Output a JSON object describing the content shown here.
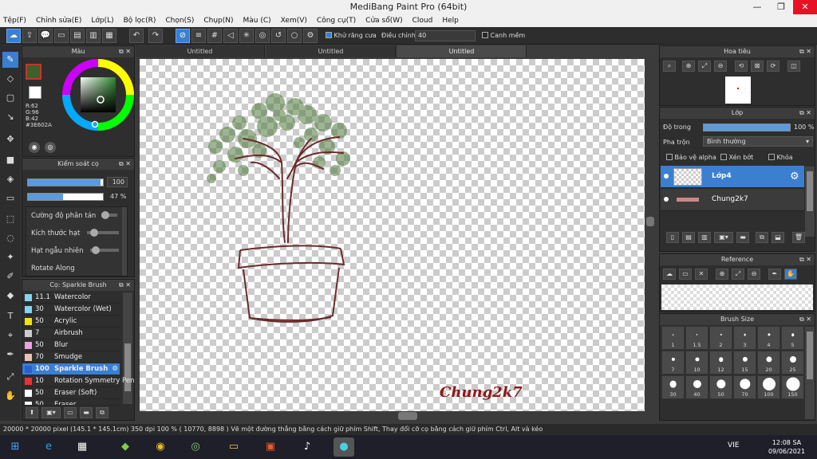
{
  "window": {
    "title": "MediBang Paint Pro (64bit)"
  },
  "menu": [
    "Tệp(F)",
    "Chỉnh sửa(E)",
    "Lớp(L)",
    "Bộ lọc(R)",
    "Chọn(S)",
    "Chụp(N)",
    "Màu (C)",
    "Xem(V)",
    "Công cụ(T)",
    "Cửa sổ(W)",
    "Cloud",
    "Help"
  ],
  "toolbar": {
    "antialias_label": "Khử răng cưa",
    "adjust_label": "Điều chỉnh",
    "adjust_value": "40",
    "edge_label": "Canh mềm"
  },
  "color_panel": {
    "title": "Màu",
    "r": "R:62",
    "g": "G:96",
    "b": "B:42",
    "hex": "#3E602A",
    "accent": "#3e602a"
  },
  "brush_control": {
    "title": "Kiểm soát cọ",
    "size_value": "100",
    "opacity_value": "47 %",
    "opacity_fraction": 0.47,
    "props": [
      "Cường độ phân tán",
      "Kích thước hạt",
      "Hạt ngẫu nhiên",
      "Rotate Along"
    ]
  },
  "brush_list": {
    "title": "Cọ: Sparkle Brush",
    "items": [
      {
        "size": "11.1",
        "name": "Watercolor",
        "color": "#7fd6f0"
      },
      {
        "size": "30",
        "name": "Watercolor (Wet)",
        "color": "#7fd6f0"
      },
      {
        "size": "50",
        "name": "Acrylic",
        "color": "#f0e020"
      },
      {
        "size": "7",
        "name": "Airbrush",
        "color": "#cccccc"
      },
      {
        "size": "50",
        "name": "Blur",
        "color": "#f0a0e0"
      },
      {
        "size": "70",
        "name": "Smudge",
        "color": "#f0c0b0"
      },
      {
        "size": "100",
        "name": "Sparkle Brush",
        "color": "#2a5fd0"
      },
      {
        "size": "10",
        "name": "Rotation Symmetry Pen",
        "color": "#f03030"
      },
      {
        "size": "50",
        "name": "Eraser (Soft)",
        "color": "#ffffff"
      },
      {
        "size": "50",
        "name": "Eraser",
        "color": "#ffffff"
      }
    ]
  },
  "tabs": [
    "Untitled",
    "Untitled",
    "Untitled"
  ],
  "canvas": {
    "signature": "Chung2k7"
  },
  "navigator": {
    "title": "Hoa tiêu"
  },
  "layers": {
    "title": "Lớp",
    "opacity_label": "Độ trong",
    "opacity_value": "100 %",
    "blend_label": "Pha trộn",
    "blend_value": "Bình thường",
    "protect_alpha": "Bảo vệ alpha",
    "clipping": "Xén bớt",
    "lock": "Khóa",
    "items": [
      {
        "name": "Lớp4"
      },
      {
        "name": "Chung2k7"
      }
    ]
  },
  "reference": {
    "title": "Reference"
  },
  "brush_size": {
    "title": "Brush Size",
    "sizes": [
      "1",
      "1.5",
      "2",
      "3",
      "4",
      "5",
      "7",
      "10",
      "12",
      "15",
      "20",
      "25",
      "30",
      "40",
      "50",
      "70",
      "100",
      "150"
    ]
  },
  "status": {
    "text": "20000 * 20000 pixel   (145.1 * 145.1cm)   350 dpi   100 %   ( 10770, 8898 )   Vẽ một đường thẳng bằng cách giữ phím Shift, Thay đổi cỡ cọ bằng cách giữ phím Ctrl, Alt và kéo"
  },
  "taskbar": {
    "lang": "VIE",
    "time": "12:08 SA",
    "date": "09/06/2021"
  }
}
